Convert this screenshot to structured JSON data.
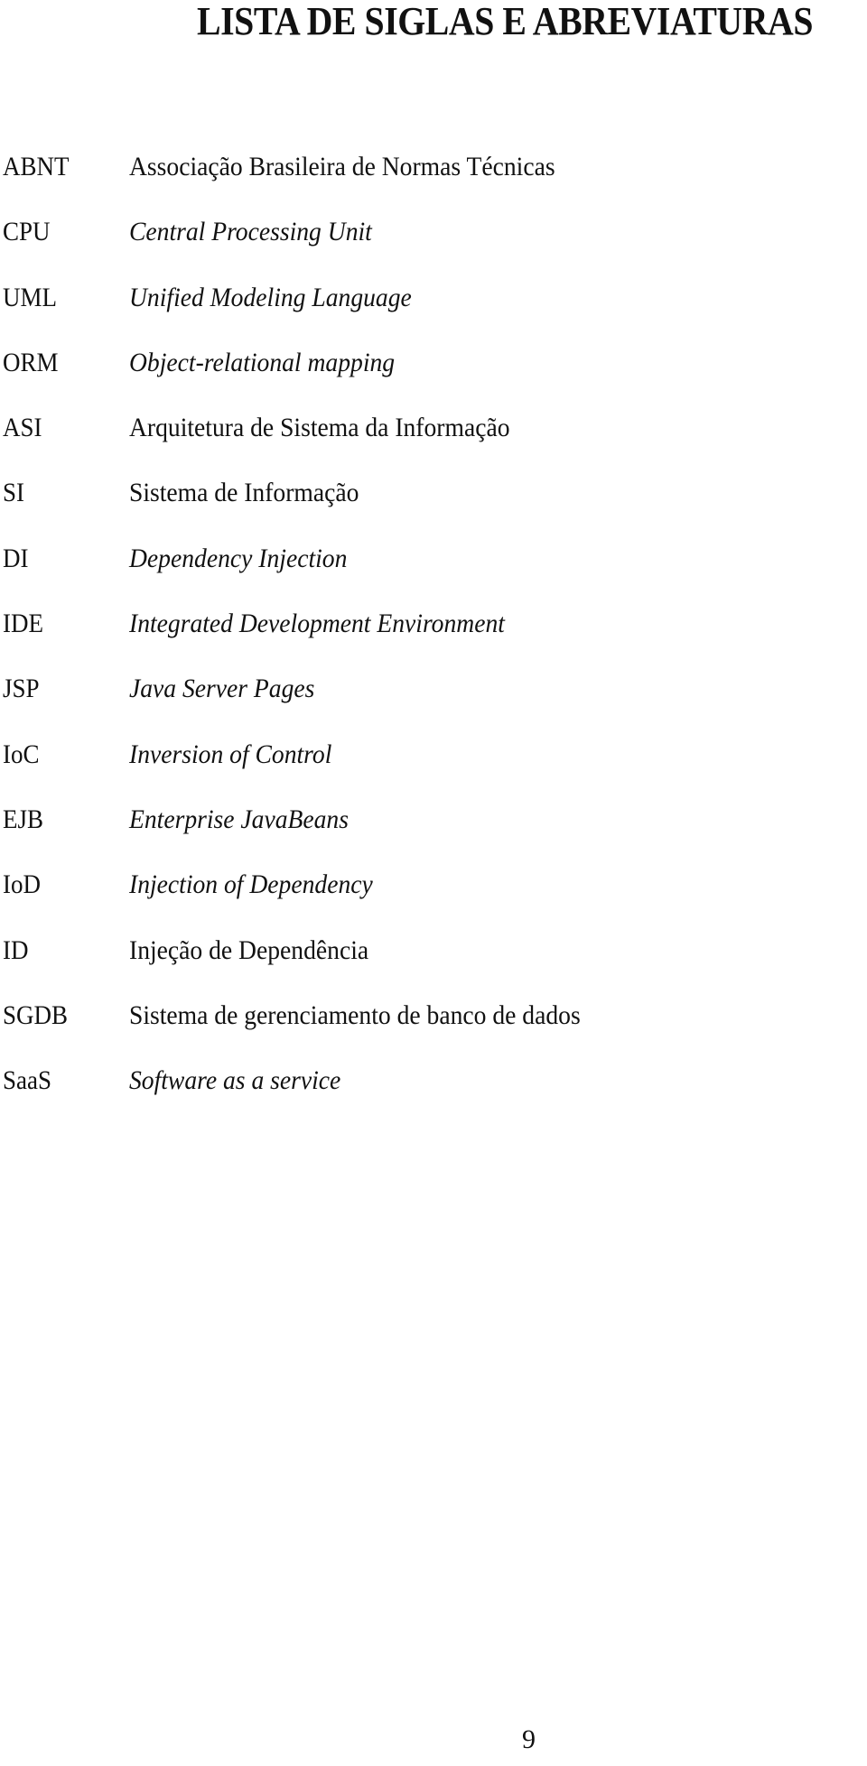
{
  "document": {
    "title": "LISTA DE SIGLAS E ABREVIATURAS",
    "page_number": "9",
    "entries": [
      {
        "term": "ABNT",
        "definition": "Associação Brasileira de Normas Técnicas",
        "italic": false
      },
      {
        "term": "CPU",
        "definition": "Central Processing Unit",
        "italic": true
      },
      {
        "term": "UML",
        "definition": "Unified Modeling Language",
        "italic": true
      },
      {
        "term": "ORM",
        "definition": "Object-relational mapping",
        "italic": true
      },
      {
        "term": "ASI",
        "definition": "Arquitetura de Sistema da Informação",
        "italic": false
      },
      {
        "term": "SI",
        "definition": "Sistema de Informação",
        "italic": false
      },
      {
        "term": "DI",
        "definition": "Dependency Injection",
        "italic": true
      },
      {
        "term": "IDE",
        "definition": "Integrated Development Environment",
        "italic": true
      },
      {
        "term": "JSP",
        "definition": "Java Server Pages",
        "italic": true
      },
      {
        "term": "IoC",
        "definition": "Inversion of Control",
        "italic": true
      },
      {
        "term": "EJB",
        "definition": "Enterprise JavaBeans",
        "italic": true
      },
      {
        "term": "IoD",
        "definition": "Injection of Dependency",
        "italic": true
      },
      {
        "term": "ID",
        "definition": "Injeção de Dependência",
        "italic": false
      },
      {
        "term": "SGDB",
        "definition": "Sistema de gerenciamento de banco de dados",
        "italic": false
      },
      {
        "term": "SaaS",
        "definition": "Software as a service",
        "italic": true
      }
    ]
  }
}
